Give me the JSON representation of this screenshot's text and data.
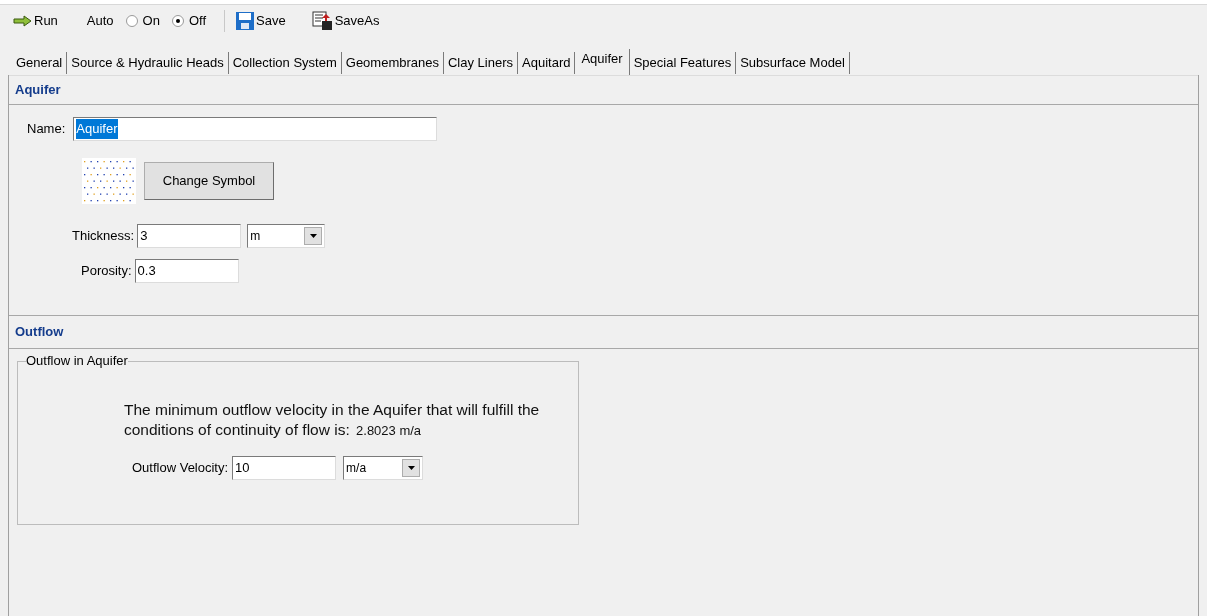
{
  "toolbar": {
    "run": "Run",
    "auto_label": "Auto",
    "auto_options": [
      {
        "label": "On",
        "selected": false
      },
      {
        "label": "Off",
        "selected": true
      }
    ],
    "save": "Save",
    "save_as": "SaveAs"
  },
  "tabs": [
    {
      "label": "General",
      "selected": false
    },
    {
      "label": "Source & Hydraulic Heads",
      "selected": false
    },
    {
      "label": "Collection System",
      "selected": false
    },
    {
      "label": "Geomembranes",
      "selected": false
    },
    {
      "label": "Clay Liners",
      "selected": false
    },
    {
      "label": "Aquitard",
      "selected": false
    },
    {
      "label": "Aquifer",
      "selected": true
    },
    {
      "label": "Special Features",
      "selected": false
    },
    {
      "label": "Subsurface Model",
      "selected": false
    }
  ],
  "aquifer": {
    "title": "Aquifer",
    "name_label": "Name:",
    "name_value": "Aquifer",
    "change_symbol": "Change Symbol",
    "thickness_label": "Thickness:",
    "thickness_value": "3",
    "thickness_unit": "m",
    "porosity_label": "Porosity:",
    "porosity_value": "0.3"
  },
  "outflow": {
    "title": "Outflow",
    "group_title": "Outflow in Aquifer",
    "message": "The minimum outflow velocity in the Aquifer that will fulfill the conditions of continuity of flow is:",
    "minimum_value": "2.8023 m/a",
    "velocity_label": "Outflow Velocity:",
    "velocity_value": "10",
    "velocity_unit": "m/a"
  }
}
